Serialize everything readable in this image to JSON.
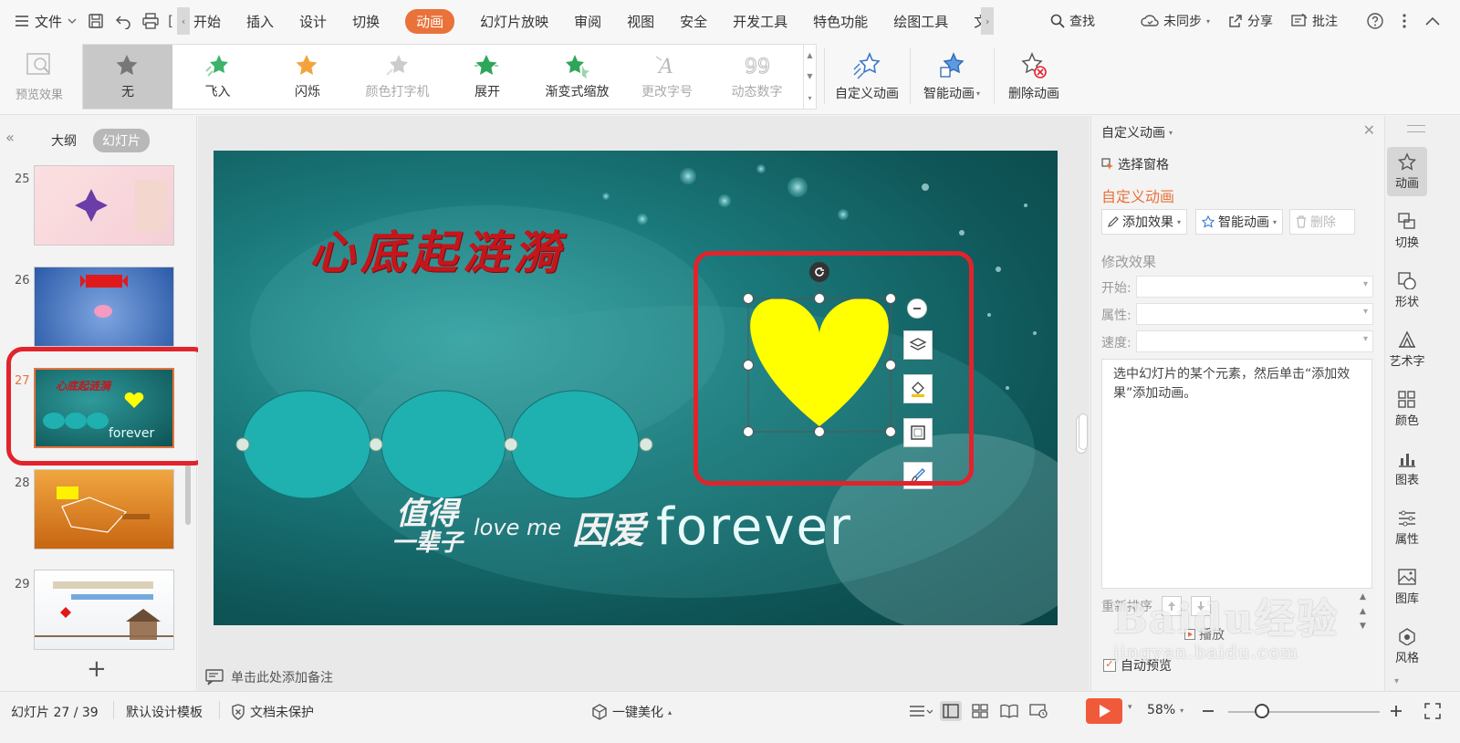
{
  "menubar": {
    "file_label": "文件",
    "tabs": [
      {
        "label": "开始",
        "active": false
      },
      {
        "label": "插入",
        "active": false
      },
      {
        "label": "设计",
        "active": false
      },
      {
        "label": "切换",
        "active": false
      },
      {
        "label": "动画",
        "active": true
      },
      {
        "label": "幻灯片放映",
        "active": false
      },
      {
        "label": "审阅",
        "active": false
      },
      {
        "label": "视图",
        "active": false
      },
      {
        "label": "安全",
        "active": false
      },
      {
        "label": "开发工具",
        "active": false
      },
      {
        "label": "特色功能",
        "active": false
      },
      {
        "label": "绘图工具",
        "active": false
      },
      {
        "label": "文",
        "active": false
      }
    ],
    "search_label": "查找",
    "sync_label": "未同步",
    "share_label": "分享",
    "comment_label": "批注"
  },
  "ribbon": {
    "preview_label": "预览效果",
    "gallery": [
      {
        "label": "无",
        "icon": "star-plain-icon",
        "selected": true,
        "enabled": true
      },
      {
        "label": "飞入",
        "icon": "star-fly-icon",
        "selected": false,
        "enabled": true
      },
      {
        "label": "闪烁",
        "icon": "star-flash-icon",
        "selected": false,
        "enabled": true
      },
      {
        "label": "颜色打字机",
        "icon": "star-typewriter-icon",
        "selected": false,
        "enabled": false
      },
      {
        "label": "展开",
        "icon": "star-expand-icon",
        "selected": false,
        "enabled": true
      },
      {
        "label": "渐变式缩放",
        "icon": "star-zoom-icon",
        "selected": false,
        "enabled": true
      },
      {
        "label": "更改字号",
        "icon": "font-size-icon",
        "selected": false,
        "enabled": false
      },
      {
        "label": "动态数字",
        "icon": "dynamic-number-icon",
        "selected": false,
        "enabled": false
      }
    ],
    "custom_animation_label": "自定义动画",
    "smart_animation_label": "智能动画",
    "delete_animation_label": "删除动画"
  },
  "leftpanel": {
    "outline_label": "大纲",
    "slides_label": "幻灯片",
    "thumbnails": [
      {
        "num": "25",
        "current": false
      },
      {
        "num": "26",
        "current": false
      },
      {
        "num": "27",
        "current": true
      },
      {
        "num": "28",
        "current": false
      },
      {
        "num": "29",
        "current": false
      }
    ],
    "add_label": "+"
  },
  "slide": {
    "title": "心底起涟漪",
    "bottom_cn1": "值得",
    "bottom_en": "love me",
    "bottom_cn2": "一辈子",
    "bottom_cn3": "因爱",
    "bottom_forever": "forever"
  },
  "canvas": {
    "notes_placeholder": "单击此处添加备注"
  },
  "taskpane": {
    "title": "自定义动画",
    "select_pane_label": "选择窗格",
    "section_title": "自定义动画",
    "add_effect_label": "添加效果",
    "smart_animation_label": "智能动画",
    "delete_label": "删除",
    "modify_label": "修改效果",
    "start_label": "开始:",
    "property_label": "属性:",
    "speed_label": "速度:",
    "hint_text": "选中幻灯片的某个元素，然后单击“添加效果”添加动画。",
    "reorder_label": "重新排序",
    "play_label": "播放",
    "auto_preview_label": "自动预览"
  },
  "sidebar": {
    "items": [
      {
        "label": "动画",
        "icon": "animation-star-icon",
        "active": true
      },
      {
        "label": "切换",
        "icon": "transition-icon",
        "active": false
      },
      {
        "label": "形状",
        "icon": "shape-icon",
        "active": false
      },
      {
        "label": "艺术字",
        "icon": "art-text-icon",
        "active": false
      },
      {
        "label": "颜色",
        "icon": "color-grid-icon",
        "active": false
      },
      {
        "label": "图表",
        "icon": "chart-icon",
        "active": false
      },
      {
        "label": "属性",
        "icon": "properties-icon",
        "active": false
      },
      {
        "label": "图库",
        "icon": "gallery-icon",
        "active": false
      },
      {
        "label": "风格",
        "icon": "style-icon",
        "active": false
      }
    ]
  },
  "statusbar": {
    "slide_counter": "幻灯片 27 / 39",
    "template_label": "默认设计模板",
    "protect_label": "文档未保护",
    "beautify_label": "一键美化",
    "zoom": "58%",
    "zoom_fraction": 0.22
  },
  "watermark": {
    "text": "Baidu经验",
    "sub": "jingyan.baidu.com"
  },
  "colors": {
    "accent": "#e9723a",
    "highlight_red": "#e2232c",
    "heart_yellow": "#ffff00",
    "slide_teal": "#1b7a7c"
  }
}
